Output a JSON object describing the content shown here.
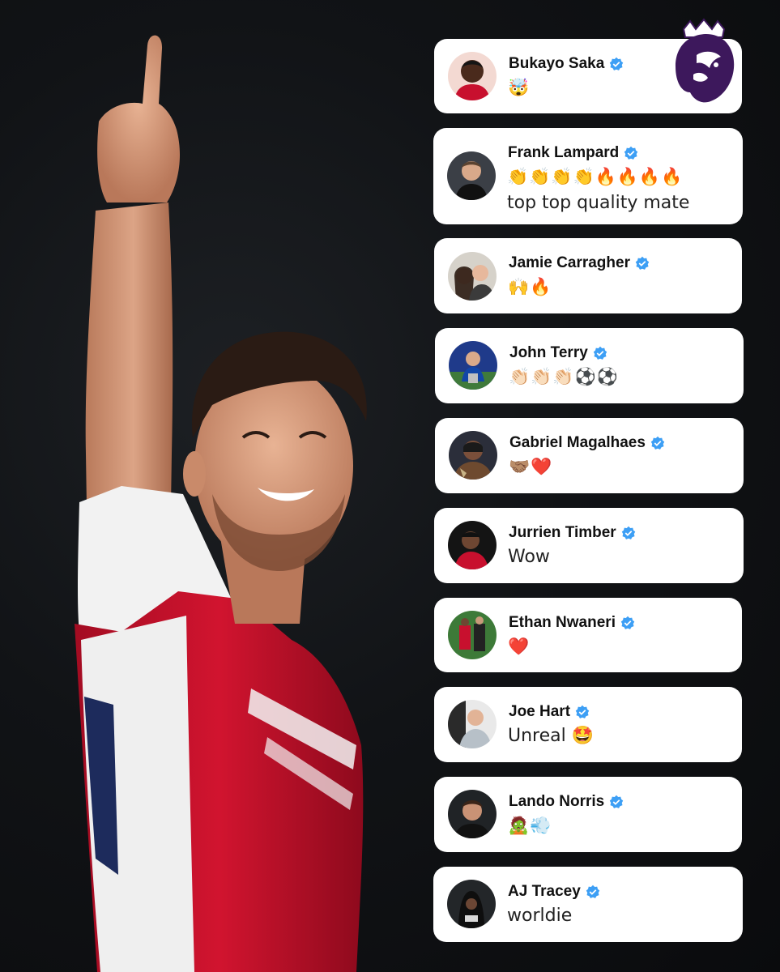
{
  "comments": [
    {
      "name": "Bukayo Saka",
      "text": "🤯"
    },
    {
      "name": "Frank Lampard",
      "text": "👏👏👏👏🔥🔥🔥🔥",
      "text2": "top top quality mate"
    },
    {
      "name": "Jamie Carragher",
      "text": "🙌🔥"
    },
    {
      "name": "John Terry",
      "text": "👏🏻👏🏻👏🏻⚽⚽"
    },
    {
      "name": "Gabriel Magalhaes",
      "text": "🤝🏽❤️"
    },
    {
      "name": "Jurrien Timber",
      "text": "Wow"
    },
    {
      "name": "Ethan Nwaneri",
      "text": "❤️"
    },
    {
      "name": "Joe Hart",
      "text": "Unreal 🤩"
    },
    {
      "name": "Lando Norris",
      "text": "🧟💨"
    },
    {
      "name": "AJ Tracey",
      "text": "worldie"
    }
  ],
  "colors": {
    "verified": "#3d9ff5",
    "shirt_red": "#c8102e",
    "pl_purple": "#3d185c"
  },
  "icons": {
    "verified": "verified-badge-icon",
    "league_logo": "premier-league-lion-icon"
  }
}
